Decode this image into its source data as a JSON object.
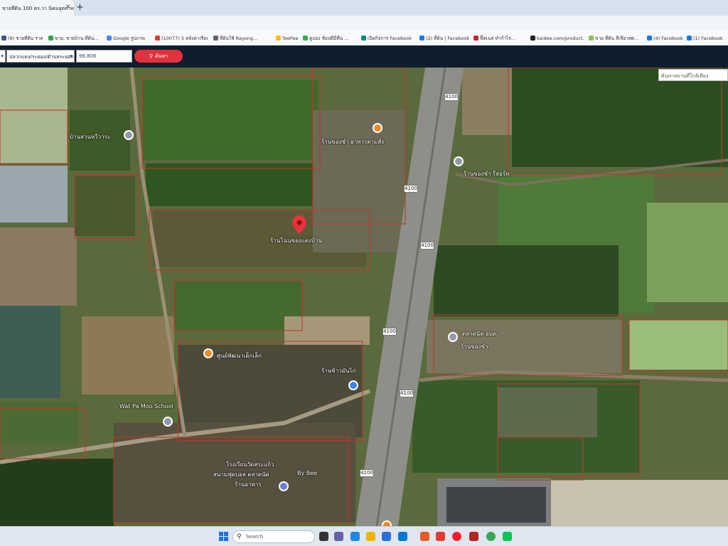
{
  "browser": {
    "tab_title": "ขายที่ดิน 100 ตร.วา นิคมอุตสาห",
    "tab_close": "×",
    "new_tab": "+"
  },
  "bookmarks": [
    {
      "label": "(9) ขายที่ดิน ราคาถูก",
      "color": "#3b5998"
    },
    {
      "label": "ขาย, ขายบ้าน-ที่ดิน...",
      "color": "#2aa84a"
    },
    {
      "label": "Google รูปภาพ",
      "color": "#4285f4"
    },
    {
      "label": "(10077) 5 หลังคาเรือน...",
      "color": "#e53935"
    },
    {
      "label": "ที่ดินใช้ Rayong...",
      "color": "#5f6368"
    },
    {
      "label": "TeePee",
      "color": "#fbbc04"
    },
    {
      "label": "คูปอง ช้อปดีมีคืน ...",
      "color": "#34a853"
    },
    {
      "label": "เปิดกิจการ Facebook",
      "color": "#00897b"
    },
    {
      "label": "(2) ที่ดิน | Facebook",
      "color": "#1877f2"
    },
    {
      "label": "ฟิ๊ตเนส ทำกำไร...",
      "color": "#c62828"
    },
    {
      "label": "kaidee.com/product...",
      "color": "#222222"
    },
    {
      "label": "ขาย ที่ดิน สีเขียวสด...",
      "color": "#8bc34a"
    },
    {
      "label": "(4) Facebook",
      "color": "#1877f2"
    },
    {
      "label": "(1) Facebook",
      "color": "#1877f2"
    }
  ],
  "toolbar": {
    "province_value": "",
    "district_value": "ปลวกแดง/ระยอง/ตำบลระยอง",
    "parcel_input_value": "98,806",
    "search_label": "ค้นหา"
  },
  "map": {
    "search_placeholder": "ค้นหาสถานที่ใกล้เคียง",
    "road_number": "4100",
    "labels": [
      "บ้านสวนหวีวาระ",
      "ร้านของชำ อาหารตามสั่ง",
      "ร้านของชำ รีสอร์ท",
      "ร้านโนนของแต่งบ้าน",
      "ศูนย์พัฒนาเด็กเล็ก",
      "ตลาดนัด อบต.",
      "ร้านข้าวมันไก่",
      "ร้านของชำ",
      "Wat Pa Moo School",
      "โรงเรียนวัดสระแก้ว",
      "สนามฟุตบอล ตลาดนัด",
      "By Bee",
      "ร้านอาหาร"
    ]
  },
  "taskbar": {
    "search_label": "Search"
  },
  "colors": {
    "toolbar_bg": "#0f1d2e",
    "search_button": "#e3323d",
    "parcel_line": "#c0392b"
  }
}
